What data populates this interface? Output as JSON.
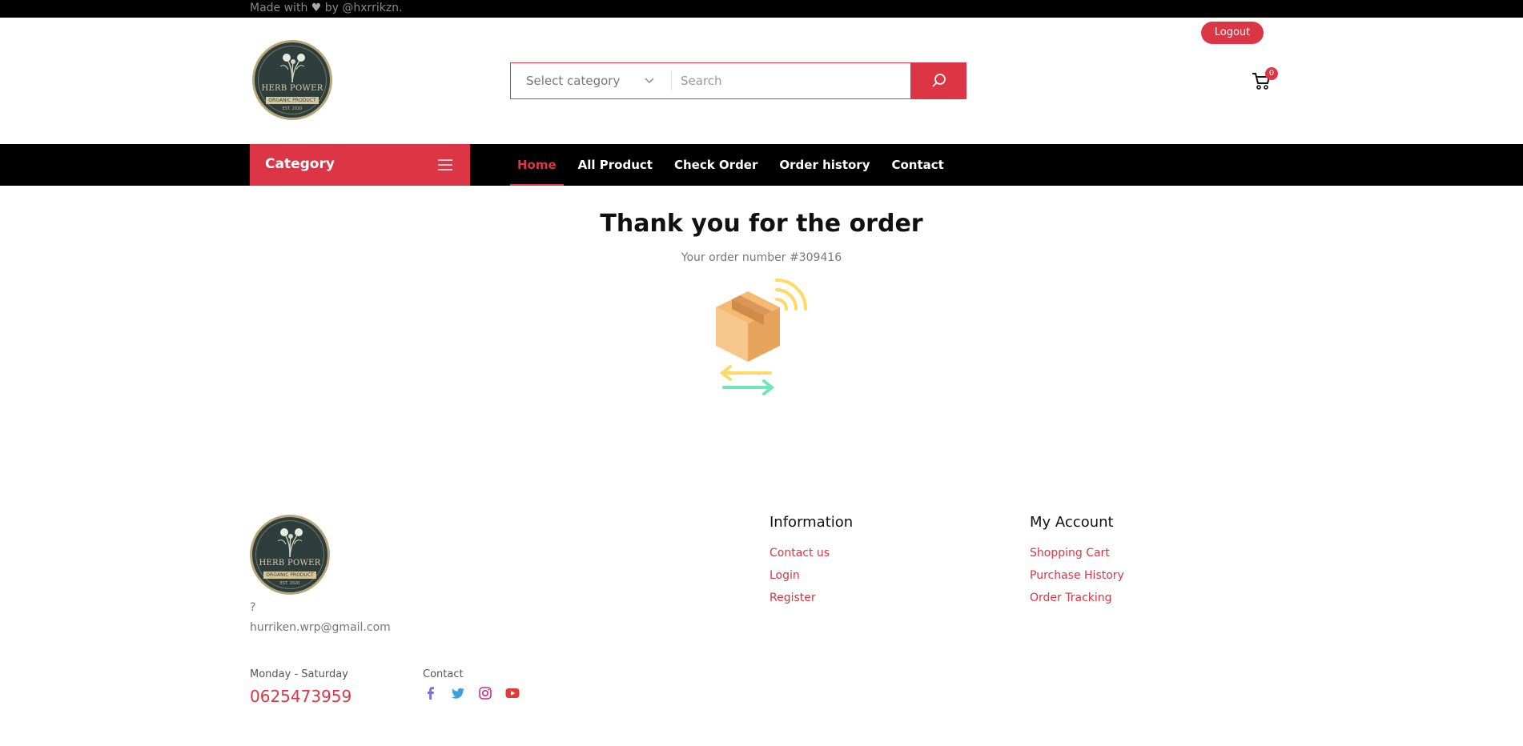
{
  "topbar": {
    "made_with_prefix": "Made with",
    "made_with_suffix": "by @hxrrikzn."
  },
  "header": {
    "logout_label": "Logout",
    "logo": {
      "brand": "HERB POWER",
      "ribbon": "ORGANIC PRODUCT",
      "tiny": "EST. 2020"
    },
    "search": {
      "category_label": "Select category",
      "placeholder": "Search"
    },
    "cart_count": "0"
  },
  "nav": {
    "category_label": "Category",
    "items": [
      {
        "label": "Home",
        "active": true
      },
      {
        "label": "All Product"
      },
      {
        "label": "Check Order"
      },
      {
        "label": "Order history"
      },
      {
        "label": "Contact"
      }
    ]
  },
  "main": {
    "title": "Thank you for the order",
    "order_number": "Your order number #309416"
  },
  "footer": {
    "question": "?",
    "email": "hurriken.wrp@gmail.com",
    "hours_label": "Monday - Saturday",
    "phone": "0625473959",
    "contact_label": "Contact",
    "socials": [
      "facebook-icon",
      "twitter-icon",
      "instagram-icon",
      "youtube-icon"
    ],
    "information": {
      "title": "Information",
      "links": [
        "Contact us",
        "Login",
        "Register"
      ]
    },
    "my_account": {
      "title": "My Account",
      "links": [
        "Shopping Cart",
        "Purchase History",
        "Order Tracking"
      ]
    }
  },
  "colors": {
    "accent": "#dc3545",
    "nav_bg": "#000000"
  }
}
